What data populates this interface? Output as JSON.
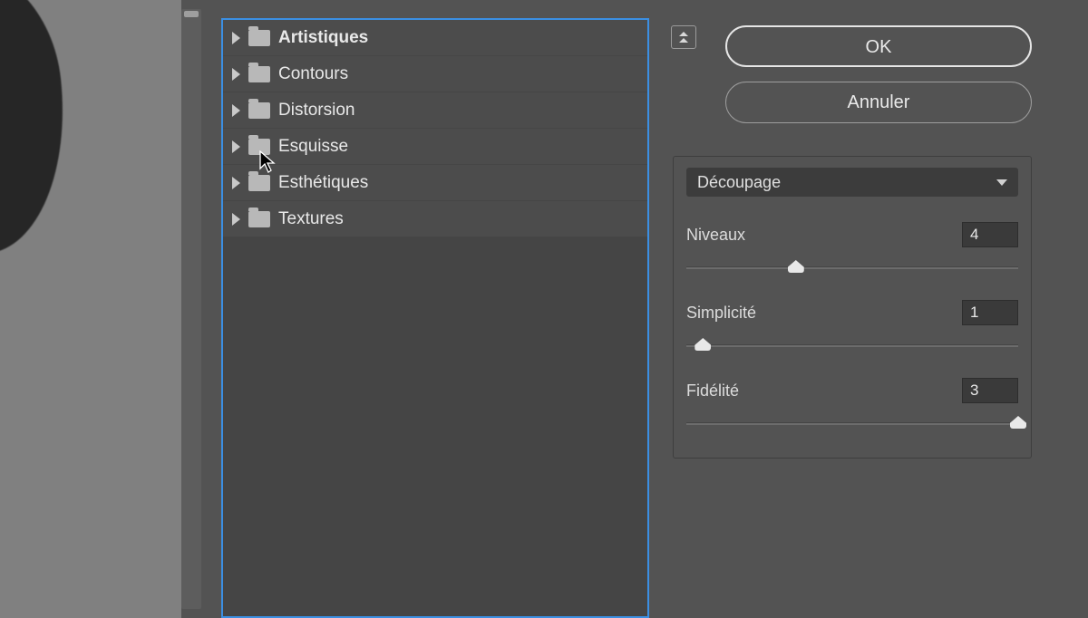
{
  "filter_tree": {
    "items": [
      {
        "label": "Artistiques",
        "bold": true
      },
      {
        "label": "Contours",
        "bold": false
      },
      {
        "label": "Distorsion",
        "bold": false
      },
      {
        "label": "Esquisse",
        "bold": false
      },
      {
        "label": "Esthétiques",
        "bold": false
      },
      {
        "label": "Textures",
        "bold": false
      }
    ]
  },
  "buttons": {
    "ok": "OK",
    "cancel": "Annuler"
  },
  "effect_dropdown": {
    "selected": "Découpage"
  },
  "params": [
    {
      "label": "Niveaux",
      "value": "4",
      "handle_pct": 33
    },
    {
      "label": "Simplicité",
      "value": "1",
      "handle_pct": 5
    },
    {
      "label": "Fidélité",
      "value": "3",
      "handle_pct": 100
    }
  ]
}
